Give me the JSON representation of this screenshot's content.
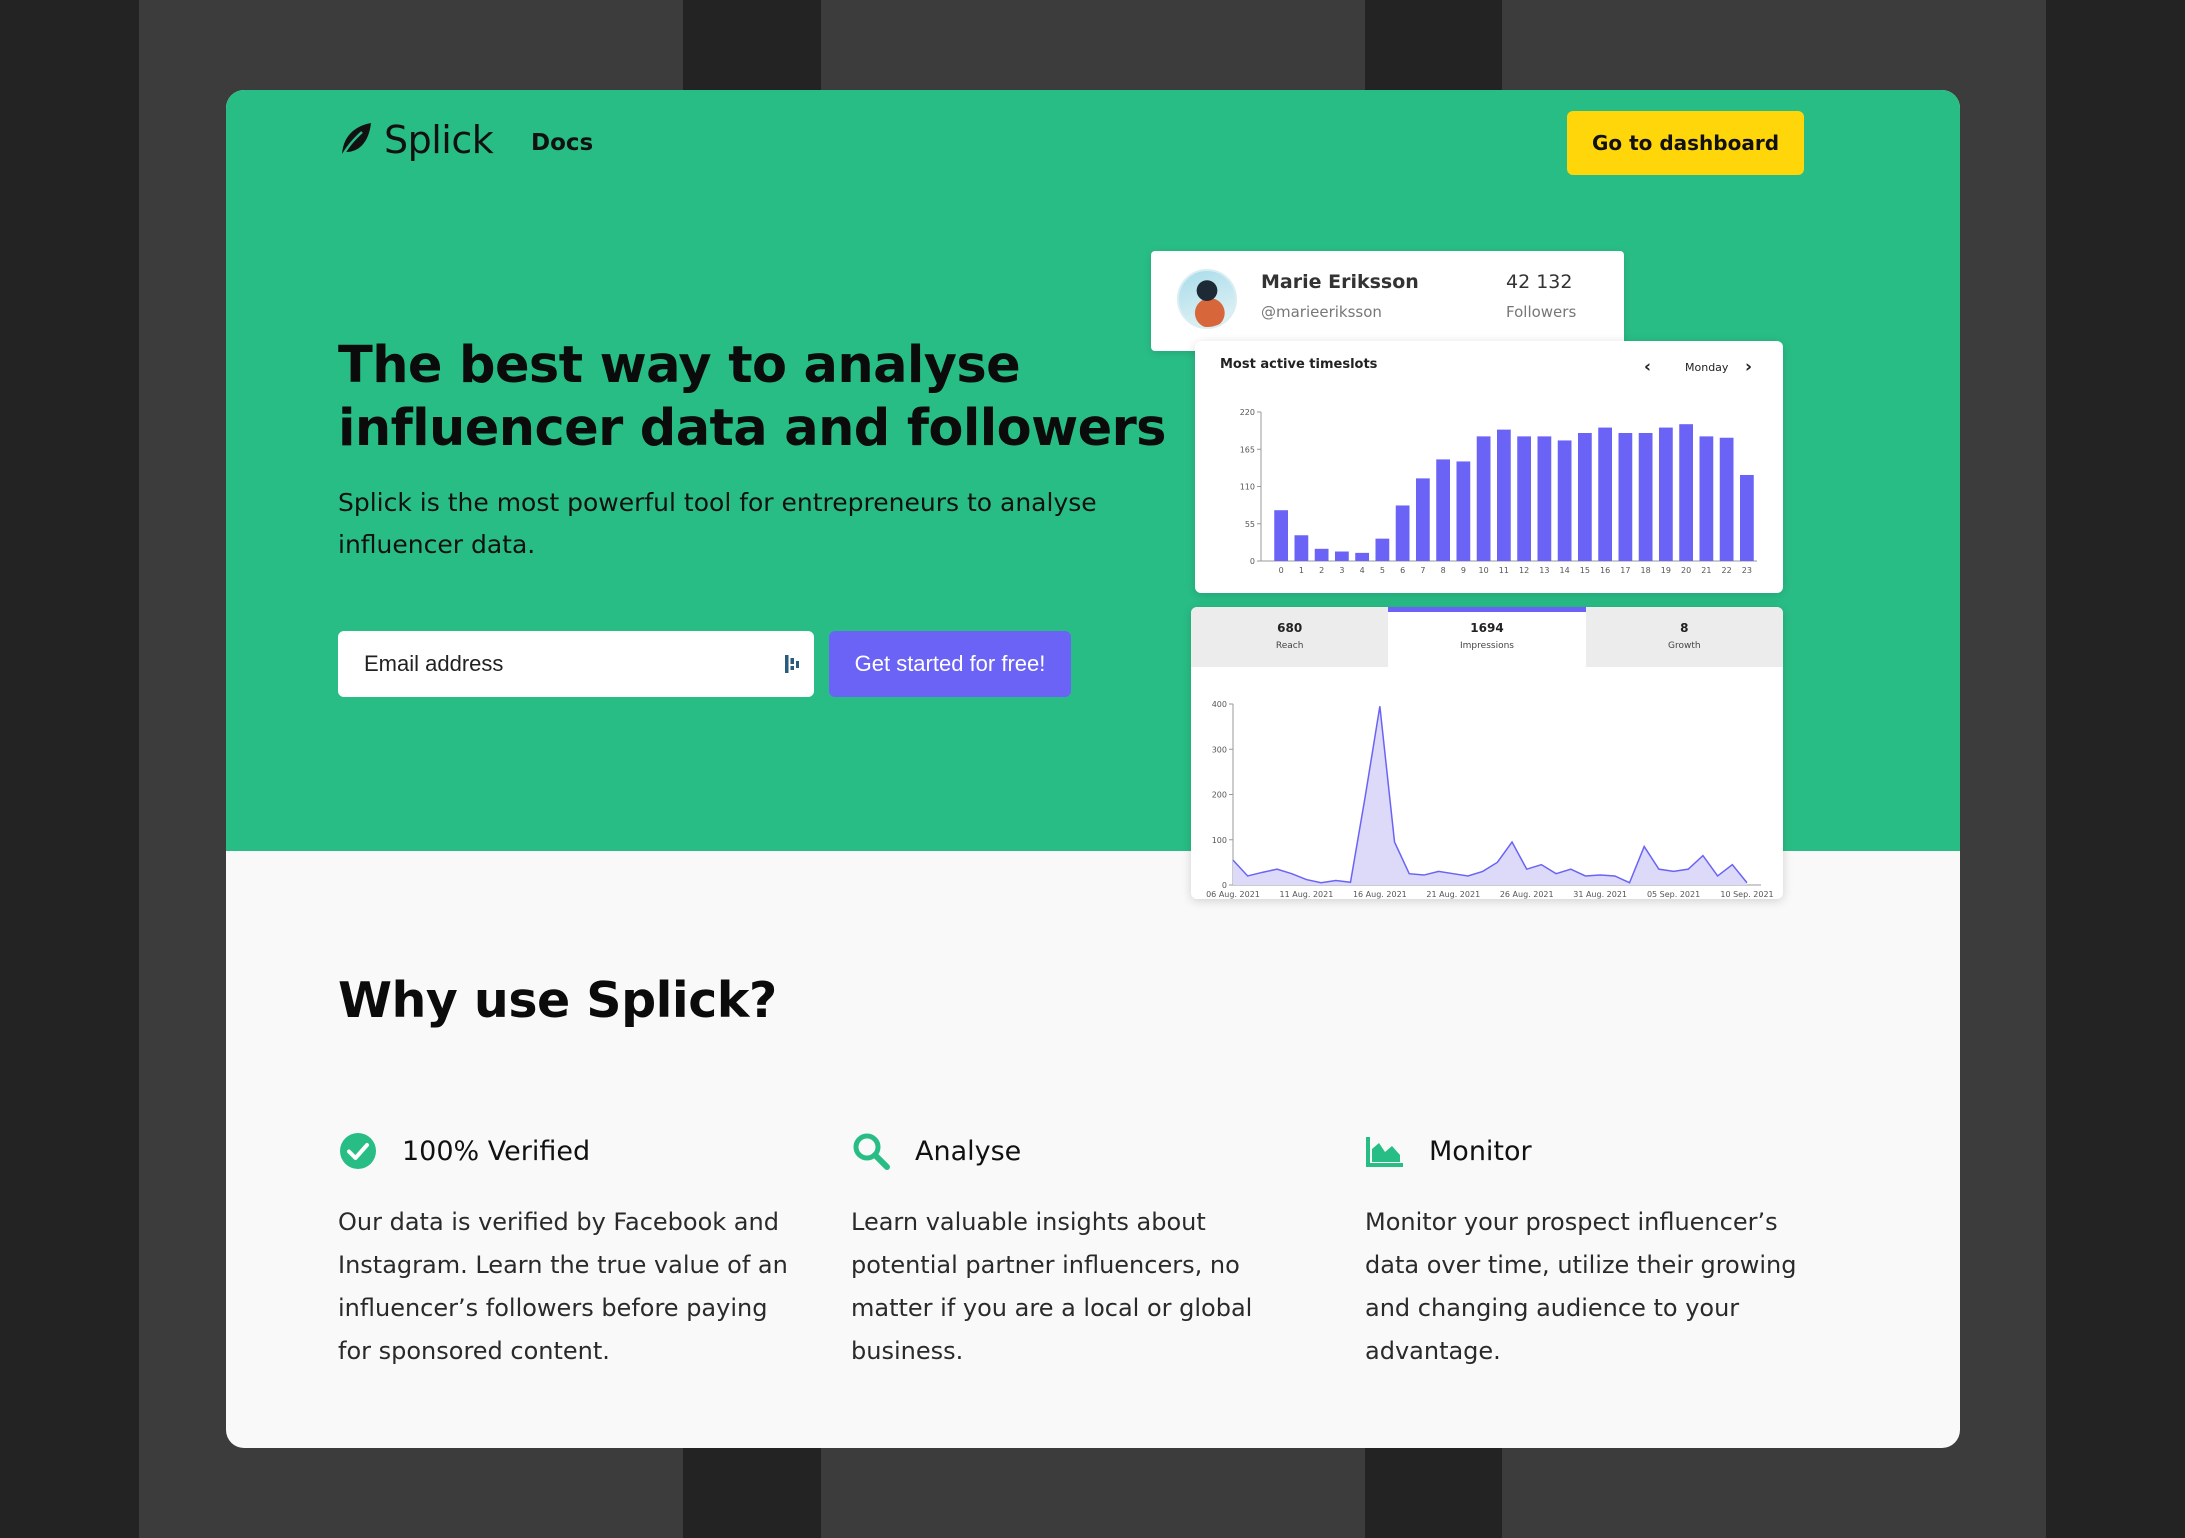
{
  "colors": {
    "background": "#232323",
    "stripe": "#3c3c3c",
    "hero": "#29bd86",
    "accent": "#6b63f6",
    "cta_yellow": "#ffd60a",
    "section_bg": "#f9f9f9"
  },
  "nav": {
    "brand": "Splick",
    "logo_icon": "leaf-icon",
    "docs_label": "Docs",
    "dashboard_button": "Go to dashboard"
  },
  "hero": {
    "headline": "The best way to analyse influencer data and followers",
    "subline": "Splick is the most powerful tool for entrepreneurs to analyse influencer data.",
    "email_placeholder": "Email address",
    "password_manager_icon": "password-manager-icon",
    "cta_label": "Get started for free!"
  },
  "profile": {
    "name": "Marie Eriksson",
    "handle": "@marieeriksson",
    "followers_count": "42 132",
    "followers_label": "Followers"
  },
  "timeslots": {
    "title": "Most active timeslots",
    "day": "Monday",
    "prev_icon": "chevron-left-icon",
    "next_icon": "chevron-right-icon"
  },
  "metrics": {
    "tabs": [
      {
        "value": "680",
        "label": "Reach"
      },
      {
        "value": "1694",
        "label": "Impressions"
      },
      {
        "value": "8",
        "label": "Growth"
      }
    ],
    "active_tab": 1
  },
  "chart_data": [
    {
      "type": "bar",
      "categories": [
        "0",
        "1",
        "2",
        "3",
        "4",
        "5",
        "6",
        "7",
        "8",
        "9",
        "10",
        "11",
        "12",
        "13",
        "14",
        "15",
        "16",
        "17",
        "18",
        "19",
        "20",
        "21",
        "22",
        "23"
      ],
      "values": [
        75,
        38,
        18,
        14,
        12,
        33,
        82,
        122,
        150,
        147,
        184,
        194,
        184,
        184,
        178,
        189,
        197,
        189,
        189,
        197,
        202,
        184,
        182,
        127
      ],
      "yticks": [
        0,
        55,
        110,
        165,
        220
      ],
      "ylim": [
        0,
        220
      ],
      "color": "#6b63f6"
    },
    {
      "type": "area",
      "x": [
        "06 Aug. 2021",
        "07 Aug. 2021",
        "08 Aug. 2021",
        "09 Aug. 2021",
        "10 Aug. 2021",
        "11 Aug. 2021",
        "12 Aug. 2021",
        "13 Aug. 2021",
        "14 Aug. 2021",
        "15 Aug. 2021",
        "16 Aug. 2021",
        "17 Aug. 2021",
        "18 Aug. 2021",
        "19 Aug. 2021",
        "20 Aug. 2021",
        "21 Aug. 2021",
        "22 Aug. 2021",
        "23 Aug. 2021",
        "24 Aug. 2021",
        "25 Aug. 2021",
        "26 Aug. 2021",
        "27 Aug. 2021",
        "28 Aug. 2021",
        "29 Aug. 2021",
        "30 Aug. 2021",
        "31 Aug. 2021",
        "01 Sep. 2021",
        "02 Sep. 2021",
        "03 Sep. 2021",
        "04 Sep. 2021",
        "05 Sep. 2021",
        "06 Sep. 2021",
        "07 Sep. 2021",
        "08 Sep. 2021",
        "09 Sep. 2021",
        "10 Sep. 2021"
      ],
      "values": [
        55,
        20,
        28,
        35,
        25,
        12,
        5,
        10,
        6,
        195,
        395,
        95,
        25,
        22,
        30,
        25,
        20,
        30,
        50,
        95,
        35,
        45,
        25,
        35,
        20,
        22,
        20,
        5,
        85,
        35,
        30,
        35,
        65,
        20,
        45,
        5
      ],
      "xticks": [
        "06 Aug. 2021",
        "11 Aug. 2021",
        "16 Aug. 2021",
        "21 Aug. 2021",
        "26 Aug. 2021",
        "31 Aug. 2021",
        "05 Sep. 2021",
        "10 Sep. 2021"
      ],
      "yticks": [
        0,
        100,
        200,
        300,
        400
      ],
      "ylim": [
        0,
        400
      ],
      "color": "#6b63f6"
    }
  ],
  "why": {
    "title": "Why use Splick?",
    "features": [
      {
        "icon": "check-circle-icon",
        "title": "100% Verified",
        "description": "Our data is verified by Facebook and Instagram. Learn the true value of an influencer’s followers before paying for sponsored content."
      },
      {
        "icon": "search-icon",
        "title": "Analyse",
        "description": "Learn valuable insights about potential partner influencers, no matter if you are a local or global business."
      },
      {
        "icon": "area-chart-icon",
        "title": "Monitor",
        "description": "Monitor your prospect influencer’s data over time, utilize their growing and changing audience to your advantage."
      }
    ]
  }
}
